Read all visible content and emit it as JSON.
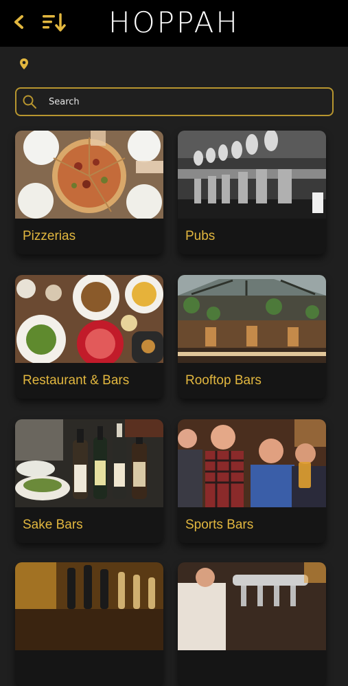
{
  "header": {
    "logo": "HOPPAH",
    "back_icon": "chevron-left-icon",
    "sort_icon": "sort-icon"
  },
  "location": {
    "icon": "map-pin-icon"
  },
  "search": {
    "placeholder": "Search",
    "icon": "search-icon"
  },
  "colors": {
    "accent": "#e2b73f",
    "background": "#1f1f1f",
    "topbar": "#000000"
  },
  "categories": [
    {
      "label": "Pizzerias",
      "image": "pizza-photo"
    },
    {
      "label": "Pubs",
      "image": "pub-taps-photo"
    },
    {
      "label": "Restaurant & Bars",
      "image": "restaurant-dishes-photo"
    },
    {
      "label": "Rooftop Bars",
      "image": "rooftop-bar-photo"
    },
    {
      "label": "Sake Bars",
      "image": "sake-bottles-photo"
    },
    {
      "label": "Sports Bars",
      "image": "sports-fans-photo"
    },
    {
      "label": "",
      "image": "beer-taps-photo"
    },
    {
      "label": "",
      "image": "bartender-photo"
    }
  ]
}
